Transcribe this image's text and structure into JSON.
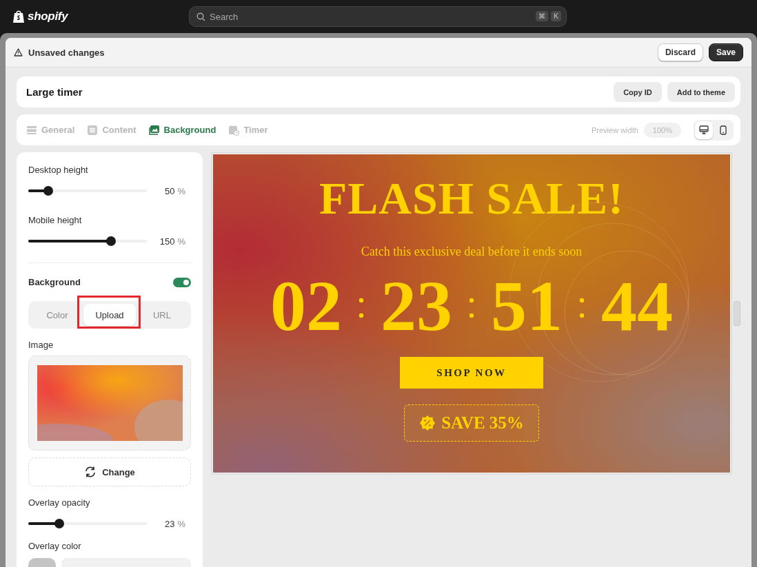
{
  "topbar": {
    "logo": "shopify",
    "search": {
      "placeholder": "Search",
      "shortcut": [
        "⌘",
        "K"
      ]
    }
  },
  "unsaved_bar": {
    "message": "Unsaved changes",
    "buttons": [
      {
        "label": "Discard",
        "kind": "secondary"
      },
      {
        "label": "Save",
        "kind": "primary"
      }
    ]
  },
  "header": {
    "title": "Large timer",
    "buttons": [
      "Copy ID",
      "Add to theme"
    ]
  },
  "tabs": [
    {
      "label": "General",
      "selected": false
    },
    {
      "label": "Content",
      "selected": false
    },
    {
      "label": "Background",
      "selected": true
    },
    {
      "label": "Timer",
      "selected": false
    }
  ],
  "preview_width": {
    "label": "Preview width",
    "value": "100%"
  },
  "devices": [
    {
      "kind": "desktop",
      "selected": true
    },
    {
      "kind": "mobile",
      "selected": false
    }
  ],
  "settings": {
    "sliders_top": [
      {
        "label": "Desktop height",
        "level": 0.17,
        "value": "50",
        "unit": "%"
      },
      {
        "label": "Mobile height",
        "level": 0.7,
        "value": "150",
        "unit": "%"
      }
    ],
    "background": {
      "label": "Background",
      "on": true
    },
    "source_options": [
      {
        "label": "Color",
        "selected": false
      },
      {
        "label": "Upload",
        "selected": true
      },
      {
        "label": "URL",
        "selected": false
      }
    ],
    "image": {
      "label": "Image",
      "change_button": "Change"
    },
    "sliders_bottom": [
      {
        "label": "Overlay opacity",
        "level": 0.26,
        "value": "23",
        "unit": "%"
      }
    ],
    "overlay_color": {
      "label": "Overlay color"
    }
  },
  "preview": {
    "headline": "FLASH SALE!",
    "subtitle": "Catch this exclusive deal before it ends soon",
    "countdown": [
      "02",
      "23",
      "51",
      "44"
    ],
    "button": "SHOP NOW",
    "coupon": "SAVE 35%"
  }
}
